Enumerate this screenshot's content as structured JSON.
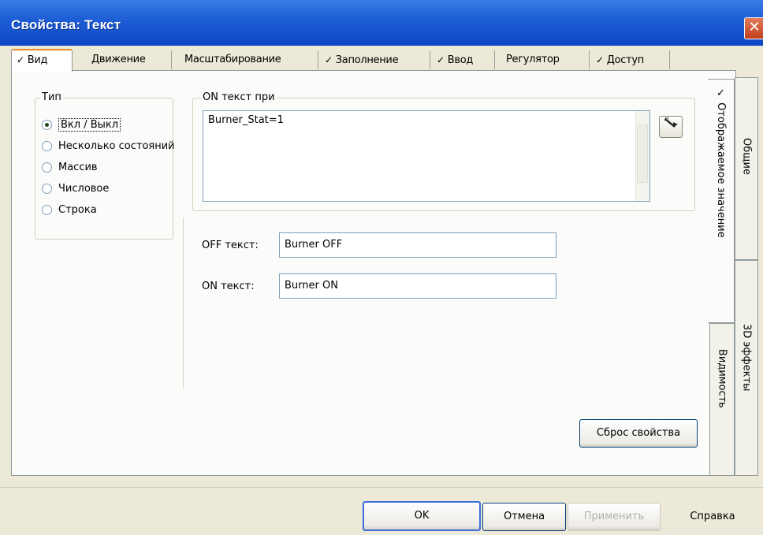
{
  "window": {
    "title": "Свойства: Текст",
    "close_glyph": "✕"
  },
  "tabs": [
    {
      "label": "Вид",
      "checked": true,
      "active": true
    },
    {
      "label": "Движение",
      "checked": false
    },
    {
      "label": "Масштабирование",
      "checked": false
    },
    {
      "label": "Заполнение",
      "checked": true
    },
    {
      "label": "Ввод",
      "checked": true
    },
    {
      "label": "Регулятор",
      "checked": false
    },
    {
      "label": "Доступ",
      "checked": true
    }
  ],
  "check_glyph": "✓",
  "side_tabs": {
    "display_value": "✓ Отображаемое значение",
    "general": "Общие",
    "effects_3d": "3D эффекты",
    "visibility": "Видимость"
  },
  "type_group": {
    "legend": "Тип",
    "options": [
      {
        "label": "Вкл / Выкл",
        "selected": true
      },
      {
        "label": "Несколько состояний",
        "selected": false
      },
      {
        "label": "Массив",
        "selected": false
      },
      {
        "label": "Числовое",
        "selected": false
      },
      {
        "label": "Строка",
        "selected": false
      }
    ]
  },
  "on_text_group": {
    "legend": "ON текст при",
    "expression": "Burner_Stat=1",
    "wand_icon": "magic-wand-icon"
  },
  "off_text": {
    "label": "OFF текст:",
    "value": "Burner OFF"
  },
  "on_text": {
    "label": "ON текст:",
    "value": "Burner ON"
  },
  "buttons": {
    "reset": "Сброс свойства",
    "ok": "OK",
    "cancel": "Отмена",
    "apply": "Применить",
    "help": "Справка"
  },
  "colors": {
    "titlebar": "#0d47c4",
    "tab_accent": "#e68b2c",
    "close": "#c0401c"
  }
}
